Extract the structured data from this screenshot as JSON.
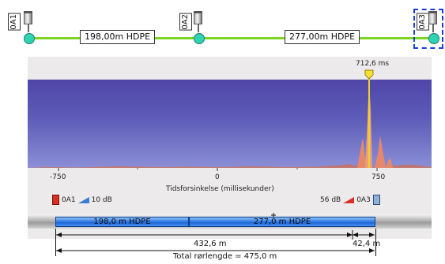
{
  "network": {
    "nodes": [
      {
        "id": "0A1"
      },
      {
        "id": "0A2"
      },
      {
        "id": "0A3"
      }
    ],
    "segments": [
      {
        "label": "198,00m HDPE"
      },
      {
        "label": "277,00m HDPE"
      }
    ],
    "colors": {
      "pipe": "#7ed321",
      "node": "#2fd3b4",
      "selection": "#1a3fd4"
    }
  },
  "spectrum": {
    "peak_label": "712,6 ms",
    "x_ticks": [
      "-750",
      "0",
      "750"
    ],
    "x_axis_title": "Tidsforsinkelse (millisekunder)",
    "legend_left": {
      "sensor": "0A1",
      "gain": "10 dB"
    },
    "legend_right": {
      "gain": "56 dB",
      "sensor": "0A3"
    }
  },
  "pipe_bar": {
    "segments": [
      "198,0 m HDPE",
      "277,0 m HDPE"
    ]
  },
  "distances": {
    "to_leak": "432,6 m",
    "remaining": "42,4 m",
    "total": "Total rørlengde = 475,0 m"
  },
  "chart_data": {
    "type": "area",
    "x_ticks": [
      -750,
      0,
      750
    ],
    "xlabel": "Tidsforsinkelse (millisekunder)",
    "peak": {
      "x": 712.6,
      "label": "712,6 ms"
    }
  }
}
